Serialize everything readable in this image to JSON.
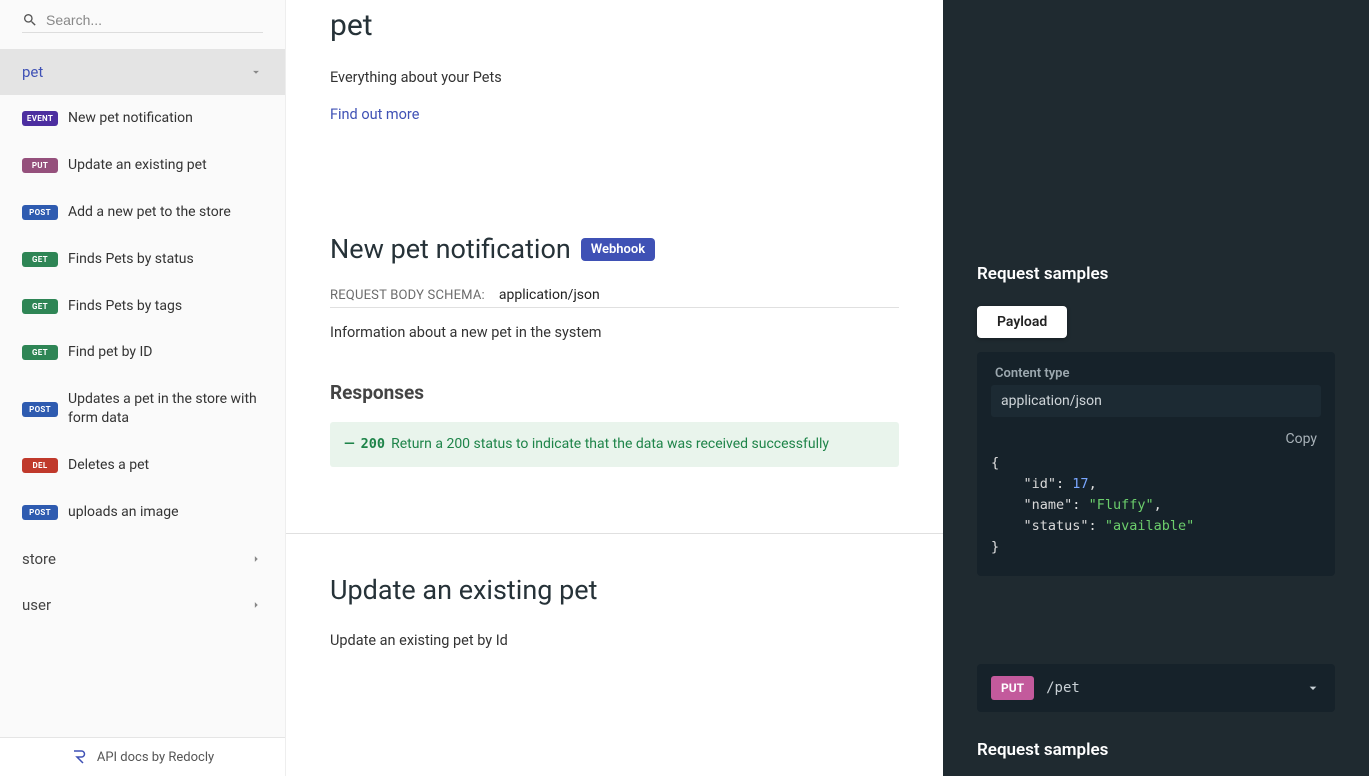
{
  "search": {
    "placeholder": "Search..."
  },
  "sidebar": {
    "sections": [
      {
        "label": "pet",
        "active": true,
        "open": true
      },
      {
        "label": "store",
        "active": false,
        "open": false
      },
      {
        "label": "user",
        "active": false,
        "open": false
      }
    ],
    "items": [
      {
        "method": "EVENT",
        "method_class": "event",
        "label": "New pet notification"
      },
      {
        "method": "PUT",
        "method_class": "put",
        "label": "Update an existing pet"
      },
      {
        "method": "POST",
        "method_class": "post",
        "label": "Add a new pet to the store"
      },
      {
        "method": "GET",
        "method_class": "get",
        "label": "Finds Pets by status"
      },
      {
        "method": "GET",
        "method_class": "get",
        "label": "Finds Pets by tags"
      },
      {
        "method": "GET",
        "method_class": "get",
        "label": "Find pet by ID"
      },
      {
        "method": "POST",
        "method_class": "post",
        "label": "Updates a pet in the store with form data"
      },
      {
        "method": "DEL",
        "method_class": "del",
        "label": "Deletes a pet"
      },
      {
        "method": "POST",
        "method_class": "post",
        "label": "uploads an image"
      }
    ]
  },
  "footer": {
    "text": "API docs by Redocly"
  },
  "tag": {
    "title": "pet",
    "description": "Everything about your Pets",
    "link": "Find out more"
  },
  "op1": {
    "title": "New pet notification",
    "badge": "Webhook",
    "schema_label": "REQUEST BODY SCHEMA:",
    "schema_value": "application/json",
    "schema_desc": "Information about a new pet in the system",
    "responses_heading": "Responses",
    "response": {
      "code": "200",
      "text": "Return a 200 status to indicate that the data was received successfully"
    }
  },
  "op2": {
    "title": "Update an existing pet",
    "desc": "Update an existing pet by Id"
  },
  "samples": {
    "heading": "Request samples",
    "tab": "Payload",
    "content_type_label": "Content type",
    "content_type_value": "application/json",
    "copy": "Copy",
    "json": {
      "id": 17,
      "name": "Fluffy",
      "status": "available"
    }
  },
  "endpoint": {
    "method": "PUT",
    "path": "/pet"
  },
  "samples2": {
    "heading": "Request samples"
  }
}
